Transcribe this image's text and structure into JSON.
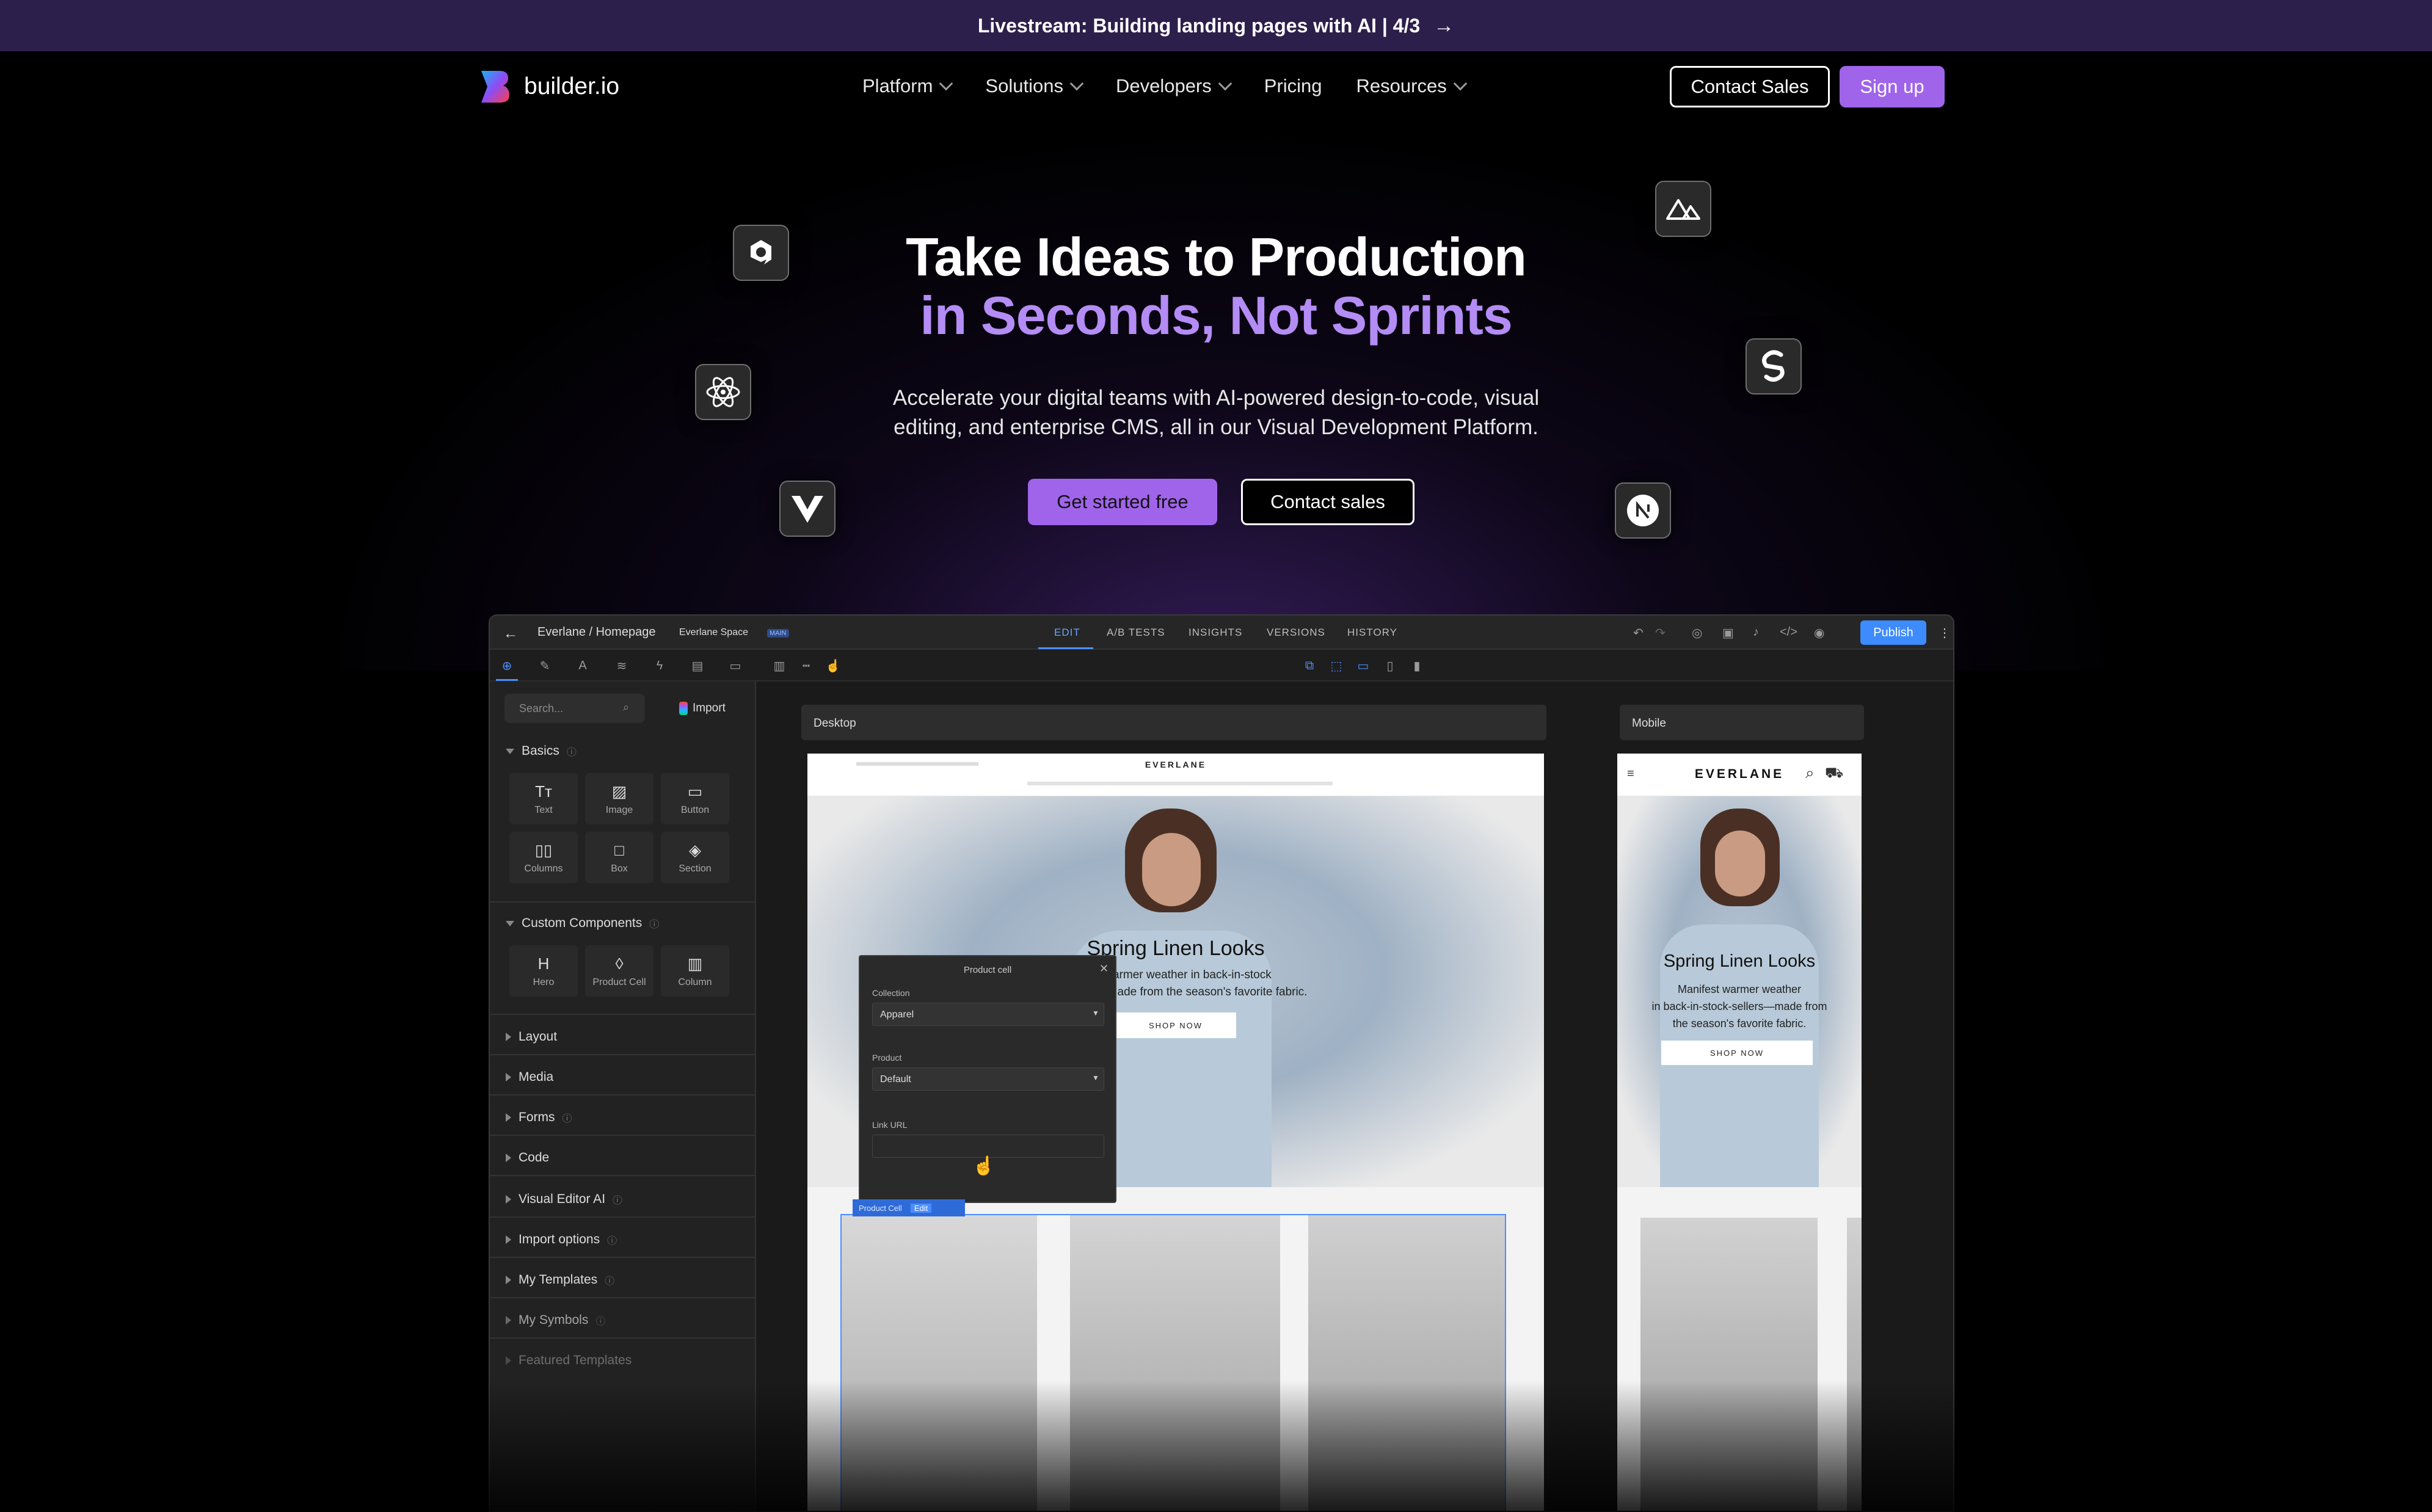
{
  "banner": {
    "text": "Livestream: Building landing pages with AI | 4/3",
    "arrow": "→"
  },
  "nav": {
    "logo_text": "builder.io",
    "menu": [
      {
        "label": "Platform",
        "dropdown": true
      },
      {
        "label": "Solutions",
        "dropdown": true
      },
      {
        "label": "Developers",
        "dropdown": true
      },
      {
        "label": "Pricing",
        "dropdown": false
      },
      {
        "label": "Resources",
        "dropdown": true
      }
    ],
    "contact_sales": "Contact Sales",
    "sign_up": "Sign up"
  },
  "hero": {
    "title_line1": "Take Ideas to Production",
    "title_line2": "in Seconds, Not Sprints",
    "subtitle_line1": "Accelerate your digital teams with AI-powered design-to-code, visual",
    "subtitle_line2": "editing, and enterprise CMS, all in our Visual Development Platform.",
    "cta_primary": "Get started free",
    "cta_secondary": "Contact sales",
    "framework_icons": [
      "qwik-icon",
      "react-icon",
      "vue-icon",
      "nuxt-icon",
      "svelte-icon",
      "next-icon"
    ]
  },
  "editor": {
    "breadcrumb": "Everlane / Homepage",
    "space": "Everlane Space",
    "space_badge": "MAIN",
    "tabs": [
      "EDIT",
      "A/B TESTS",
      "INSIGHTS",
      "VERSIONS",
      "HISTORY"
    ],
    "active_tab": "EDIT",
    "publish": "Publish",
    "search_placeholder": "Search...",
    "import": "Import",
    "basics_title": "Basics",
    "basics": [
      "Text",
      "Image",
      "Button",
      "Columns",
      "Box",
      "Section"
    ],
    "custom_title": "Custom Components",
    "custom": [
      "Hero",
      "Product Cell",
      "Column"
    ],
    "collapsed_sections": [
      "Layout",
      "Media",
      "Forms",
      "Code",
      "Visual Editor AI",
      "Import options",
      "My Templates",
      "My Symbols",
      "Featured Templates"
    ],
    "desktop_label": "Desktop",
    "mobile_label": "Mobile",
    "site": {
      "brand": "EVERLANE",
      "headline": "Spring Linen Looks",
      "desktop_body_line1": "warmer weather in back-in-stock",
      "desktop_body_line2": "ade from the season's favorite fabric.",
      "mobile_body_line1": "Manifest warmer weather",
      "mobile_body_line2": "in back-in-stock-sellers—made from",
      "mobile_body_line3": "the season's favorite fabric.",
      "shop_now": "SHOP NOW"
    },
    "popup": {
      "title": "Product cell",
      "collection_label": "Collection",
      "collection_value": "Apparel",
      "product_label": "Product",
      "product_value": "Default",
      "link_label": "Link URL",
      "tag": "Product Cell",
      "tag_edit": "Edit"
    }
  },
  "colors": {
    "accent": "#a064ea",
    "headline_accent": "#b48cf5",
    "banner_bg": "#2d1f4b",
    "publish_blue": "#3d8bfd"
  }
}
